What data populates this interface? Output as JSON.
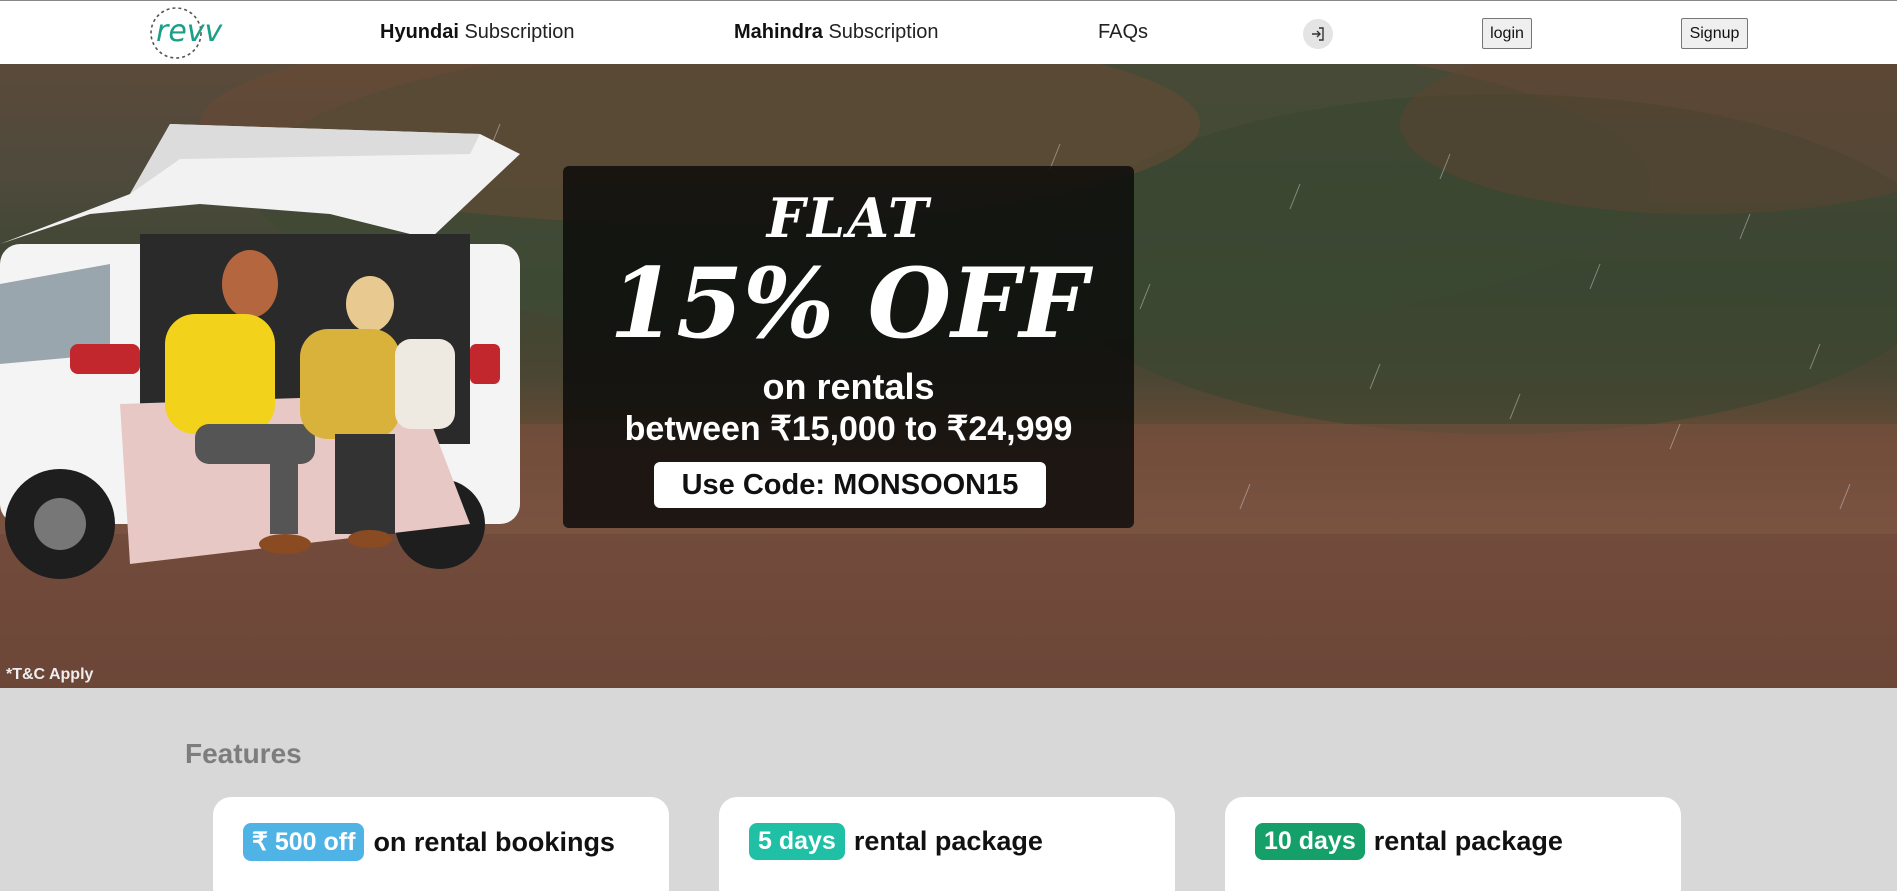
{
  "header": {
    "logo_text": "revv",
    "nav": [
      {
        "bold": "Hyundai",
        "rest": " Subscription"
      },
      {
        "bold": "Mahindra",
        "rest": " Subscription"
      },
      {
        "label": "FAQs"
      }
    ],
    "login_label": "login",
    "signup_label": "Signup"
  },
  "hero": {
    "promo_flat": "FLAT",
    "promo_big": "15% OFF",
    "promo_line1": "on rentals",
    "promo_line2": "between ₹15,000 to ₹24,999",
    "promo_code": "Use Code: MONSOON15",
    "tnc": "*T&C Apply"
  },
  "features": {
    "title": "Features",
    "cards": [
      {
        "pill": "₹ 500 off",
        "text": "on rental bookings",
        "pill_color": "#4fb3e6"
      },
      {
        "pill": "5 days",
        "text": "rental package",
        "pill_color": "#1fc0a6"
      },
      {
        "pill": "10 days",
        "text": "rental package",
        "pill_color": "#14a068"
      }
    ]
  }
}
